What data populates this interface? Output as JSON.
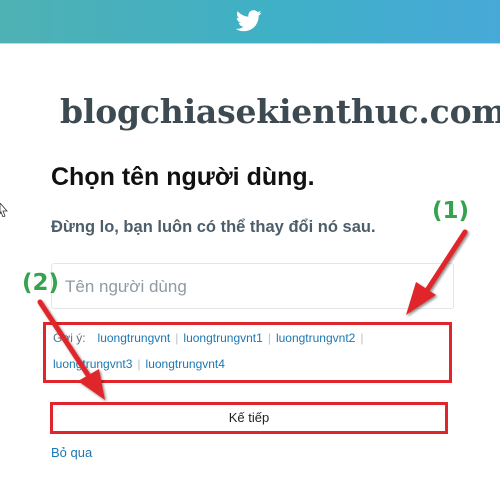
{
  "header": {
    "icon": "twitter-bird-icon",
    "bg_color": "#45b0c8"
  },
  "watermark": {
    "text": "blogchiasekienthuc.com"
  },
  "form": {
    "title": "Chọn tên người dùng.",
    "subtitle": "Đừng lo, bạn luôn có thể thay đổi nó sau.",
    "username_placeholder": "Tên người dùng",
    "suggestion_label": "Gợi ý:",
    "suggestions": [
      "luongtrungvnt",
      "luongtrungvnt1",
      "luongtrungvnt2",
      "luongtrungvnt3",
      "luongtrungvnt4"
    ],
    "next_label": "Kế tiếp",
    "skip_label": "Bỏ qua"
  },
  "annotations": {
    "callout_1": "(1)",
    "callout_2": "(2)",
    "highlight_color": "#e0262b",
    "callout_color": "#36a24d"
  }
}
